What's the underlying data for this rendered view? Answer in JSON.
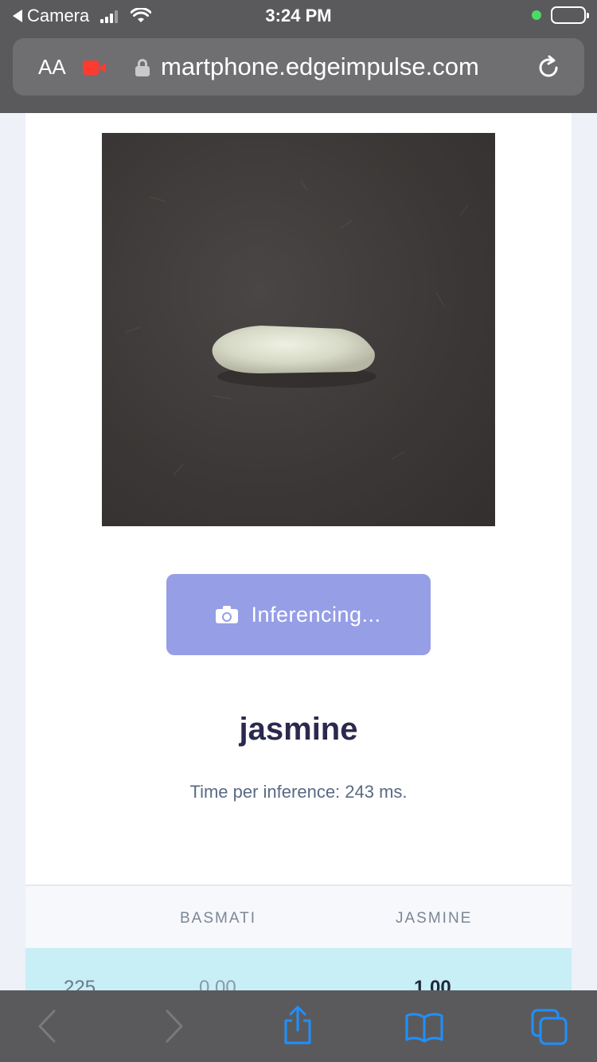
{
  "status_bar": {
    "back_app": "Camera",
    "time": "3:24 PM"
  },
  "address_bar": {
    "text_size_label": "AA",
    "url": "martphone.edgeimpulse.com"
  },
  "capture": {
    "button_label": "Inferencing..."
  },
  "result": {
    "label": "jasmine",
    "inference_time": "Time per inference: 243 ms."
  },
  "table": {
    "headers": [
      "BASMATI",
      "JASMINE"
    ],
    "rows": [
      {
        "timestamp": "225",
        "basmati": "0.00",
        "jasmine": "1.00"
      }
    ]
  },
  "colors": {
    "accent": "#969ee6",
    "chrome": "#5a5a5c",
    "row_highlight": "#c8eef6",
    "toolbar_icon": "#1e90ff",
    "record": "#ff3b30"
  },
  "icons": [
    "back-icon",
    "signal-icon",
    "wifi-icon",
    "battery-icon",
    "record-icon",
    "lock-icon",
    "reload-icon",
    "camera-icon",
    "nav-back-icon",
    "nav-forward-icon",
    "share-icon",
    "bookmarks-icon",
    "tabs-icon"
  ]
}
